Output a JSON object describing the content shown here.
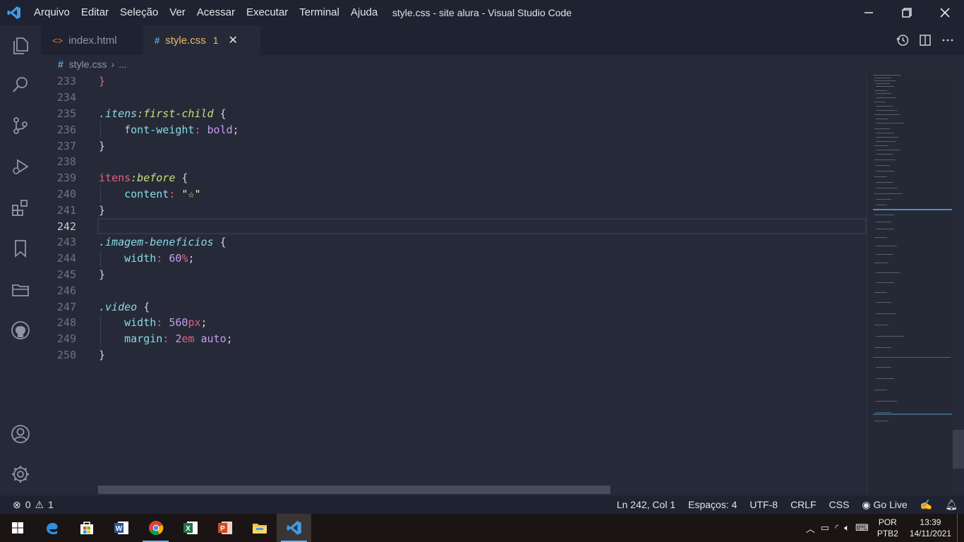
{
  "titlebar": {
    "menu": [
      "Arquivo",
      "Editar",
      "Seleção",
      "Ver",
      "Acessar",
      "Executar",
      "Terminal",
      "Ajuda"
    ],
    "title": "style.css - site alura - Visual Studio Code"
  },
  "tabs": [
    {
      "icon": "<>",
      "label": "index.html"
    },
    {
      "icon": "#",
      "label": "style.css",
      "badge": "1",
      "close": "✕"
    }
  ],
  "breadcrumb": {
    "file": "style.css",
    "rest": "..."
  },
  "editor": {
    "current_line": 242,
    "lines": [
      {
        "n": "233",
        "text": "}"
      },
      {
        "n": "234",
        "text": ""
      },
      {
        "n": "235",
        "text": ".itens:first-child {"
      },
      {
        "n": "236",
        "text": "    font-weight: bold;"
      },
      {
        "n": "237",
        "text": "}"
      },
      {
        "n": "238",
        "text": ""
      },
      {
        "n": "239",
        "text": "itens:before {"
      },
      {
        "n": "240",
        "text": "    content: \"☆\""
      },
      {
        "n": "241",
        "text": "}"
      },
      {
        "n": "242",
        "text": ""
      },
      {
        "n": "243",
        "text": ".imagem-beneficios {"
      },
      {
        "n": "244",
        "text": "    width: 60%;"
      },
      {
        "n": "245",
        "text": "}"
      },
      {
        "n": "246",
        "text": ""
      },
      {
        "n": "247",
        "text": ".video {"
      },
      {
        "n": "248",
        "text": "    width: 560px;"
      },
      {
        "n": "249",
        "text": "    margin: 2em auto;"
      },
      {
        "n": "250",
        "text": "}"
      }
    ]
  },
  "statusbar": {
    "errors": "0",
    "warnings": "1",
    "position": "Ln 242, Col 1",
    "spaces": "Espaços: 4",
    "encoding": "UTF-8",
    "eol": "CRLF",
    "language": "CSS",
    "golive": "Go Live"
  },
  "taskbar": {
    "lang": "POR",
    "layout": "PTB2",
    "time": "13:39",
    "date": "14/11/2021"
  },
  "colors": {
    "accent": "#e9b968",
    "selector": "#8ad8e6",
    "keyword": "#e4607d",
    "pseudo": "#c6e07a",
    "value": "#c79cf0"
  }
}
